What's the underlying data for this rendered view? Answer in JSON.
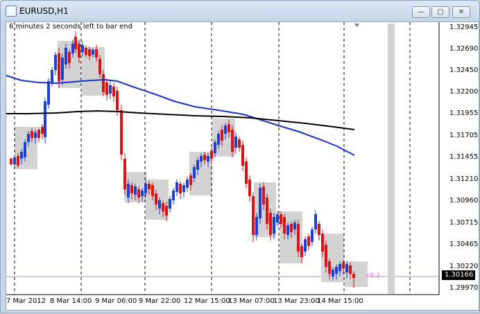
{
  "window": {
    "title": "EURUSD,H1",
    "minimize_label": "—",
    "restore_label": "▢",
    "close_label": "✕"
  },
  "chart": {
    "timer": "6 minutes 2 seconds left to bar end",
    "bar_counter": "<8.2",
    "current_price": "1.30166",
    "price_labels": [
      "1.32945",
      "1.32690",
      "1.32450",
      "1.32200",
      "1.31955",
      "1.31705",
      "1.31455",
      "1.31210",
      "1.30960",
      "1.30715",
      "1.30465",
      "1.30220",
      "1.29970"
    ],
    "date_labels": [
      "7 Mar 2012",
      "8 Mar 14:00",
      "9 Mar 06:00",
      "9 Mar 22:00",
      "12 Mar 15:00",
      "13 Mar 07:00",
      "13 Mar 23:00",
      "14 Mar 15:00"
    ],
    "colors": {
      "bull": "#1f3fd0",
      "bear": "#d91414",
      "ma_fast": "#1a2fc4",
      "ma_slow": "#000000",
      "box": "#d3d3d3"
    }
  }
}
